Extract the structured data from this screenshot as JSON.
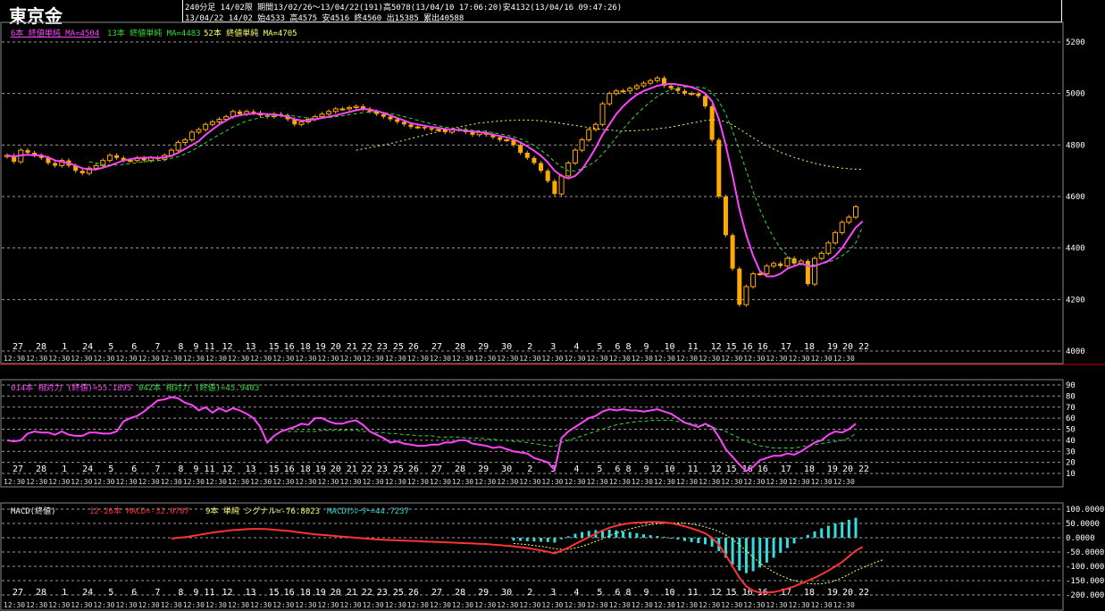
{
  "header": {
    "title": "東京金",
    "info_line1": "240分足 14/02限 期間13/02/26～13/04/22(191)高5078(13/04/10 17:06:20)安4132(13/04/16 09:47:26)",
    "info_line2": "13/04/22 14/02 始4533 高4575 安4516 終4560 出15385 累出40588"
  },
  "legends": {
    "price": [
      {
        "text": "6本 終値単純 MA=4504",
        "color": "#ff44ff"
      },
      {
        "text": "13本 終値単純 MA=4483",
        "color": "#33dd33"
      },
      {
        "text": "52本 終値単純 MA=4705",
        "color": "#ffff66"
      }
    ],
    "rsi": [
      {
        "text": "014本 相対力 (終値)=55.1895",
        "color": "#ff44ff"
      },
      {
        "text": "042本 相対力 (終値)=45.9403",
        "color": "#33dd33"
      }
    ],
    "macd": [
      {
        "text": "MACD(終値)",
        "color": "#ffffff"
      },
      {
        "text": "12-26本 MACD=-32.0787",
        "color": "#ff3333"
      },
      {
        "text": "9本 単純 シグナル=-76.8023",
        "color": "#ffff66"
      },
      {
        "text": "MACDｵｼﾚｰﾀｰ=44.7237",
        "color": "#33dddd"
      }
    ]
  },
  "colors": {
    "candle": "#ffaa00",
    "ma6": "#ff44ff",
    "ma13": "#33dd33",
    "ma52": "#ffff66",
    "macd": "#ff3333",
    "signal": "#ffff66",
    "osc": "#33dddd"
  },
  "x_labels": [
    "27",
    "28",
    "1",
    "24",
    "5",
    "6",
    "7",
    "8",
    "9 11",
    "12",
    "13",
    "15",
    "16 18",
    "19",
    "20 21",
    "22",
    "23 25",
    "26",
    "27",
    "28",
    "29",
    "30",
    "2",
    "3",
    "4",
    "5",
    "6 8",
    "9",
    "10",
    "11",
    "12",
    "15 16",
    "16",
    "17",
    "18",
    "19",
    "20 22"
  ],
  "time_label": "12:30",
  "chart_data": [
    {
      "type": "candlestick",
      "title": "東京金",
      "ylim": [
        4000,
        5250
      ],
      "yticks": [
        4000,
        4200,
        4400,
        4600,
        4800,
        5000,
        5200
      ],
      "close": [
        4760,
        4735,
        4780,
        4770,
        4760,
        4750,
        4730,
        4720,
        4740,
        4720,
        4700,
        4690,
        4710,
        4720,
        4740,
        4760,
        4750,
        4740,
        4740,
        4750,
        4740,
        4750,
        4745,
        4760,
        4780,
        4810,
        4820,
        4850,
        4860,
        4880,
        4890,
        4900,
        4910,
        4930,
        4920,
        4930,
        4925,
        4915,
        4910,
        4920,
        4915,
        4900,
        4880,
        4890,
        4900,
        4910,
        4920,
        4930,
        4940,
        4940,
        4945,
        4950,
        4940,
        4930,
        4920,
        4910,
        4900,
        4890,
        4880,
        4870,
        4870,
        4865,
        4860,
        4860,
        4850,
        4860,
        4860,
        4850,
        4840,
        4850,
        4840,
        4830,
        4820,
        4820,
        4800,
        4770,
        4750,
        4730,
        4700,
        4660,
        4610,
        4680,
        4730,
        4780,
        4820,
        4860,
        4880,
        4960,
        5000,
        5010,
        5010,
        5020,
        5030,
        5040,
        5050,
        5060,
        5030,
        5020,
        5010,
        5000,
        5000,
        4990,
        4950,
        4820,
        4600,
        4450,
        4320,
        4180,
        4250,
        4300,
        4300,
        4330,
        4340,
        4330,
        4360,
        4340,
        4350,
        4260,
        4360,
        4380,
        4420,
        4460,
        4500,
        4520,
        4560
      ],
      "ma6": [
        4760,
        4755,
        4760,
        4762,
        4760,
        4760,
        4752,
        4740,
        4735,
        4730,
        4720,
        4710,
        4705,
        4705,
        4712,
        4720,
        4730,
        4740,
        4745,
        4750,
        4750,
        4752,
        4750,
        4752,
        4758,
        4770,
        4785,
        4800,
        4815,
        4840,
        4860,
        4880,
        4895,
        4910,
        4915,
        4920,
        4922,
        4922,
        4920,
        4918,
        4915,
        4910,
        4900,
        4895,
        4895,
        4900,
        4905,
        4910,
        4915,
        4922,
        4928,
        4935,
        4940,
        4938,
        4932,
        4925,
        4915,
        4905,
        4895,
        4885,
        4880,
        4875,
        4870,
        4867,
        4862,
        4860,
        4858,
        4855,
        4852,
        4850,
        4846,
        4840,
        4835,
        4830,
        4822,
        4810,
        4795,
        4778,
        4758,
        4733,
        4700,
        4680,
        4670,
        4680,
        4705,
        4745,
        4790,
        4840,
        4880,
        4920,
        4950,
        4975,
        4995,
        5010,
        5020,
        5030,
        5035,
        5038,
        5035,
        5030,
        5025,
        5015,
        5000,
        4970,
        4900,
        4800,
        4680,
        4550,
        4450,
        4370,
        4310,
        4290,
        4290,
        4300,
        4320,
        4330,
        4340,
        4330,
        4330,
        4340,
        4350,
        4370,
        4400,
        4440,
        4480,
        4504
      ],
      "ma13": [
        null,
        null,
        null,
        null,
        null,
        null,
        null,
        null,
        null,
        null,
        null,
        null,
        4735,
        4730,
        4725,
        4722,
        4722,
        4725,
        4728,
        4732,
        4735,
        4738,
        4740,
        4742,
        4748,
        4755,
        4765,
        4778,
        4792,
        4808,
        4825,
        4840,
        4855,
        4870,
        4882,
        4893,
        4900,
        4906,
        4910,
        4913,
        4915,
        4916,
        4912,
        4908,
        4905,
        4903,
        4904,
        4906,
        4910,
        4914,
        4918,
        4922,
        4926,
        4928,
        4928,
        4926,
        4922,
        4917,
        4910,
        4903,
        4896,
        4889,
        4882,
        4875,
        4870,
        4866,
        4862,
        4860,
        4857,
        4855,
        4852,
        4848,
        4843,
        4838,
        4832,
        4824,
        4812,
        4798,
        4780,
        4760,
        4735,
        4715,
        4700,
        4700,
        4708,
        4720,
        4738,
        4765,
        4795,
        4830,
        4862,
        4892,
        4920,
        4945,
        4968,
        4988,
        5003,
        5015,
        5022,
        5025,
        5027,
        5025,
        5020,
        5005,
        4970,
        4920,
        4855,
        4780,
        4700,
        4620,
        4550,
        4490,
        4440,
        4400,
        4370,
        4350,
        4340,
        4335,
        4335,
        4340,
        4345,
        4355,
        4370,
        4390,
        4420,
        4483
      ],
      "ma52": [
        null,
        null,
        null,
        null,
        null,
        null,
        null,
        null,
        null,
        null,
        null,
        null,
        null,
        null,
        null,
        null,
        null,
        null,
        null,
        null,
        null,
        null,
        null,
        null,
        null,
        null,
        null,
        null,
        null,
        null,
        null,
        null,
        null,
        null,
        null,
        null,
        null,
        null,
        null,
        null,
        null,
        null,
        null,
        null,
        null,
        null,
        null,
        null,
        null,
        null,
        null,
        4780,
        4785,
        4790,
        4795,
        4800,
        4806,
        4812,
        4818,
        4825,
        4832,
        4838,
        4845,
        4852,
        4858,
        4864,
        4870,
        4875,
        4880,
        4885,
        4888,
        4891,
        4893,
        4895,
        4896,
        4897,
        4897,
        4896,
        4894,
        4891,
        4888,
        4884,
        4880,
        4876,
        4872,
        4868,
        4864,
        4860,
        4858,
        4856,
        4855,
        4855,
        4856,
        4858,
        4860,
        4863,
        4866,
        4870,
        4875,
        4880,
        4885,
        4890,
        4895,
        4898,
        4897,
        4890,
        4878,
        4862,
        4845,
        4828,
        4812,
        4797,
        4784,
        4772,
        4762,
        4752,
        4744,
        4736,
        4729,
        4723,
        4718,
        4714,
        4710,
        4708,
        4706,
        4705
      ]
    },
    {
      "type": "line",
      "title": "相対力",
      "ylim": [
        10,
        90
      ],
      "yticks": [
        10,
        20,
        30,
        40,
        50,
        60,
        70,
        80,
        90
      ],
      "rsi14": [
        40,
        39,
        40,
        46,
        48,
        47,
        47,
        45,
        48,
        45,
        44,
        44,
        47,
        47,
        46,
        46,
        48,
        57,
        60,
        62,
        66,
        71,
        76,
        77,
        79,
        78,
        74,
        72,
        67,
        70,
        65,
        69,
        66,
        69,
        67,
        64,
        60,
        52,
        38,
        44,
        48,
        50,
        52,
        55,
        54,
        60,
        60,
        57,
        55,
        55,
        57,
        58,
        54,
        48,
        45,
        42,
        38,
        39,
        37,
        36,
        35,
        35,
        36,
        36,
        38,
        38,
        40,
        40,
        37,
        36,
        35,
        33,
        34,
        32,
        30,
        29,
        28,
        24,
        22,
        20,
        13,
        42,
        48,
        52,
        56,
        60,
        62,
        66,
        68,
        67,
        68,
        67,
        67,
        66,
        67,
        68,
        66,
        64,
        60,
        56,
        54,
        52,
        55,
        52,
        43,
        32,
        25,
        18,
        12,
        16,
        22,
        24,
        26,
        26,
        28,
        27,
        30,
        34,
        38,
        40,
        45,
        48,
        47,
        50,
        55
      ],
      "rsi42": [
        null,
        null,
        null,
        null,
        null,
        null,
        null,
        null,
        null,
        null,
        null,
        null,
        null,
        null,
        null,
        null,
        null,
        null,
        null,
        null,
        null,
        null,
        null,
        null,
        null,
        null,
        null,
        null,
        null,
        null,
        null,
        null,
        null,
        null,
        null,
        null,
        null,
        null,
        null,
        null,
        null,
        48,
        48,
        48,
        48,
        48,
        49,
        49,
        49,
        49,
        49,
        49,
        48,
        48,
        47,
        47,
        46,
        46,
        45,
        45,
        44,
        44,
        44,
        43,
        43,
        43,
        43,
        42,
        42,
        42,
        41,
        41,
        40,
        40,
        39,
        39,
        38,
        37,
        36,
        35,
        34,
        38,
        40,
        42,
        44,
        46,
        48,
        50,
        52,
        54,
        55,
        56,
        57,
        57,
        58,
        58,
        58,
        58,
        57,
        56,
        55,
        54,
        53,
        52,
        50,
        48,
        45,
        42,
        39,
        37,
        35,
        34,
        33,
        33,
        33,
        33,
        34,
        35,
        36,
        37,
        38,
        39,
        40,
        42,
        46
      ]
    },
    {
      "type": "line",
      "title": "MACD",
      "ylim": [
        -200,
        100
      ],
      "yticks": [
        100,
        50,
        0,
        -50,
        -100,
        -150,
        -200
      ],
      "macd": [
        null,
        null,
        null,
        null,
        null,
        null,
        null,
        null,
        null,
        null,
        null,
        null,
        null,
        null,
        null,
        null,
        null,
        null,
        null,
        null,
        null,
        null,
        null,
        null,
        -3,
        0,
        2,
        6,
        10,
        14,
        18,
        21,
        24,
        27,
        28,
        30,
        31,
        31,
        30,
        28,
        26,
        24,
        21,
        18,
        15,
        12,
        10,
        8,
        6,
        4,
        2,
        0,
        -2,
        -4,
        -6,
        -7,
        -8,
        -9,
        -10,
        -11,
        -12,
        -13,
        -14,
        -15,
        -16,
        -17,
        -18,
        -19,
        -20,
        -21,
        -22,
        -24,
        -26,
        -28,
        -30,
        -33,
        -36,
        -40,
        -44,
        -49,
        -55,
        -45,
        -35,
        -22,
        -10,
        2,
        14,
        25,
        35,
        42,
        47,
        51,
        53,
        54,
        55,
        55,
        54,
        51,
        46,
        40,
        33,
        25,
        15,
        0,
        -25,
        -60,
        -100,
        -140,
        -170,
        -185,
        -192,
        -192,
        -190,
        -185,
        -178,
        -170,
        -160,
        -150,
        -140,
        -128,
        -115,
        -100,
        -85,
        -65,
        -45,
        -32
      ],
      "signal": [
        null,
        null,
        null,
        null,
        null,
        null,
        null,
        null,
        null,
        null,
        null,
        null,
        null,
        null,
        null,
        null,
        null,
        null,
        null,
        null,
        null,
        null,
        null,
        null,
        null,
        null,
        null,
        null,
        null,
        null,
        null,
        null,
        null,
        null,
        null,
        null,
        null,
        null,
        null,
        null,
        null,
        null,
        null,
        null,
        null,
        null,
        null,
        null,
        null,
        null,
        null,
        null,
        null,
        null,
        null,
        null,
        null,
        null,
        null,
        null,
        null,
        null,
        null,
        null,
        null,
        null,
        null,
        null,
        null,
        null,
        null,
        null,
        null,
        null,
        -20,
        -22,
        -24,
        -27,
        -30,
        -34,
        -38,
        -40,
        -40,
        -36,
        -30,
        -22,
        -13,
        -3,
        7,
        16,
        24,
        31,
        37,
        42,
        46,
        49,
        51,
        52,
        52,
        51,
        48,
        44,
        38,
        31,
        22,
        10,
        -6,
        -25,
        -46,
        -68,
        -88,
        -105,
        -120,
        -132,
        -142,
        -150,
        -156,
        -160,
        -162,
        -161,
        -157,
        -150,
        -140,
        -128,
        -115,
        -105,
        -95,
        -85,
        -77
      ]
    }
  ]
}
